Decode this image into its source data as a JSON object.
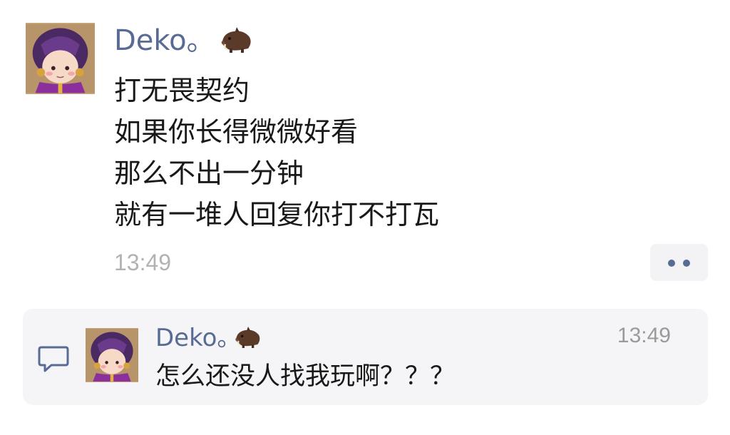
{
  "post": {
    "author": "Deko。",
    "author_emoji": "boar-icon",
    "lines": [
      "打无畏契约",
      "如果你长得微微好看",
      "那么不出一分钟",
      "就有一堆人回复你打不打瓦"
    ],
    "time": "13:49",
    "more_icon": "more-dots-icon"
  },
  "comment": {
    "icon": "comment-bubble-icon",
    "author": "Deko。",
    "author_emoji": "boar-icon",
    "time": "13:49",
    "text": "怎么还没人找我玩啊？？？"
  },
  "colors": {
    "name_link": "#576b95",
    "body_text": "#191919",
    "timestamp": "#b2b2b2",
    "panel_bg": "#f5f5f7"
  }
}
